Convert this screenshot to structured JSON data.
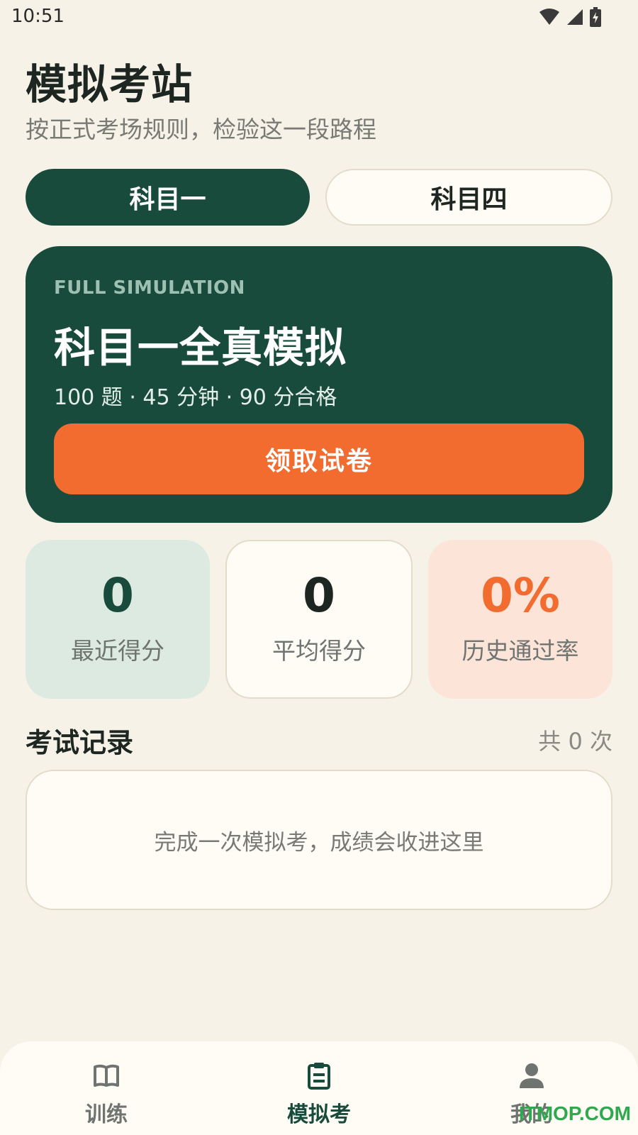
{
  "status_bar": {
    "time": "10:51",
    "icons": [
      "wifi-icon",
      "signal-icon",
      "battery-icon"
    ]
  },
  "header": {
    "title": "模拟考站",
    "subtitle": "按正式考场规则，检验这一段路程"
  },
  "tabs": [
    {
      "label": "科目一",
      "active": true
    },
    {
      "label": "科目四",
      "active": false
    }
  ],
  "hero": {
    "eyebrow": "FULL SIMULATION",
    "title": "科目一全真模拟",
    "meta": "100 题 · 45 分钟 · 90 分合格",
    "button_label": "领取试卷"
  },
  "stats": [
    {
      "value": "0",
      "label": "最近得分"
    },
    {
      "value": "0",
      "label": "平均得分"
    },
    {
      "value": "0%",
      "label": "历史通过率"
    }
  ],
  "records": {
    "title": "考试记录",
    "count": "共 0 次",
    "empty_text": "完成一次模拟考，成绩会收进这里"
  },
  "bottom_nav": [
    {
      "label": "训练",
      "icon": "book-icon",
      "active": false
    },
    {
      "label": "模拟考",
      "icon": "clipboard-icon",
      "active": true
    },
    {
      "label": "我的",
      "icon": "person-icon",
      "active": false
    }
  ],
  "watermark": "ITMOP.COM",
  "colors": {
    "background": "#F6F2E8",
    "primary_green": "#184B3C",
    "accent_orange": "#F26C30",
    "stat_green_bg": "#DCEAE1",
    "stat_orange_bg": "#FCE4D9"
  }
}
